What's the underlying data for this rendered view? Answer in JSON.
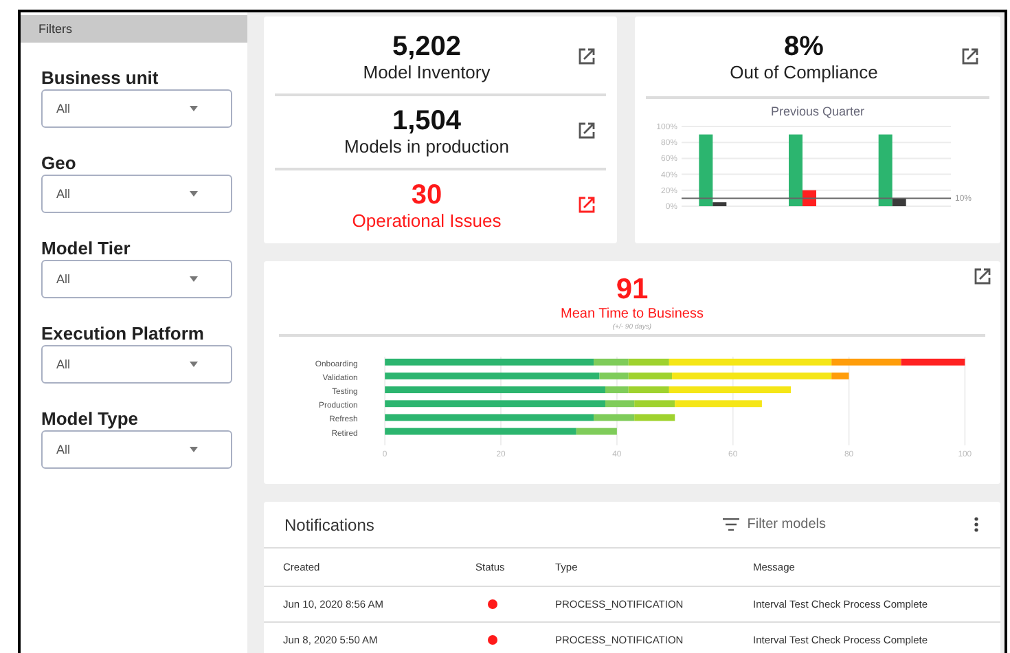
{
  "sidebar": {
    "title": "Filters",
    "filters": [
      {
        "label": "Business unit",
        "value": "All"
      },
      {
        "label": "Geo",
        "value": "All"
      },
      {
        "label": "Model Tier",
        "value": "All"
      },
      {
        "label": "Execution Platform",
        "value": "All"
      },
      {
        "label": "Model Type",
        "value": "All"
      }
    ]
  },
  "metrics": [
    {
      "value": "5,202",
      "label": "Model Inventory",
      "alert": false
    },
    {
      "value": "1,504",
      "label": "Models in production",
      "alert": false
    },
    {
      "value": "30",
      "label": "Operational Issues",
      "alert": true
    }
  ],
  "compliance": {
    "value": "8%",
    "label": "Out of Compliance",
    "alert": false,
    "chart_data": {
      "type": "bar",
      "title": "Previous Quarter",
      "ylim": [
        0,
        100
      ],
      "yticks": [
        {
          "value": 0,
          "label": "0%"
        },
        {
          "value": 20,
          "label": "20%"
        },
        {
          "value": 40,
          "label": "40%"
        },
        {
          "value": 60,
          "label": "60%"
        },
        {
          "value": 80,
          "label": "80%"
        },
        {
          "value": 100,
          "label": "100%"
        }
      ],
      "series": [
        {
          "color": "#2cb56f",
          "values": [
            90,
            90,
            90
          ]
        },
        {
          "color": "#3a3a3a",
          "values": [
            5,
            null,
            10
          ]
        },
        {
          "color": "#ff2020",
          "values": [
            null,
            20,
            null
          ]
        }
      ],
      "grid": true,
      "ref_lines": [
        {
          "axis": "y",
          "value": 10,
          "label": "10%"
        }
      ]
    }
  },
  "time_to_business": {
    "value": "91",
    "label": "Mean Time to Business",
    "note": "(+/- 90 days)",
    "alert": true,
    "chart_data": {
      "type": "bar",
      "orientation": "horizontal",
      "stacked": true,
      "grid": true,
      "categories": [
        "Onboarding",
        "Validation",
        "Testing",
        "Production",
        "Refresh",
        "Retired"
      ],
      "xlim": [
        0,
        100
      ],
      "xticks": [
        0,
        20,
        40,
        60,
        80,
        100
      ],
      "series": [
        {
          "color": "#2cb56f",
          "values": [
            36,
            37,
            38,
            38,
            36,
            33
          ]
        },
        {
          "color": "#7fcc5a",
          "values": [
            6,
            5,
            4,
            5,
            7,
            7
          ]
        },
        {
          "color": "#9fd22e",
          "values": [
            7,
            7.5,
            7,
            7,
            7,
            null
          ]
        },
        {
          "color": "#f5e617",
          "values": [
            28,
            27.5,
            21,
            15,
            null,
            null
          ]
        },
        {
          "color": "#ff9d0a",
          "values": [
            12,
            3,
            null,
            null,
            null,
            null
          ]
        },
        {
          "color": "#ff2222",
          "values": [
            11,
            null,
            null,
            null,
            null,
            null
          ]
        }
      ]
    }
  },
  "notifications": {
    "title": "Notifications",
    "filter": {
      "label": "Filter models"
    },
    "columns": [
      "Created",
      "Status",
      "Type",
      "Message"
    ],
    "rows": [
      {
        "created": "Jun 10, 2020  8:56 AM",
        "color": "#ff1a1a",
        "type": "PROCESS_NOTIFICATION",
        "message": "Interval Test Check Process Complete"
      },
      {
        "created": "Jun 8, 2020  5:50 AM",
        "color": "#ff1a1a",
        "type": "PROCESS_NOTIFICATION",
        "message": "Interval Test Check Process Complete"
      }
    ]
  }
}
